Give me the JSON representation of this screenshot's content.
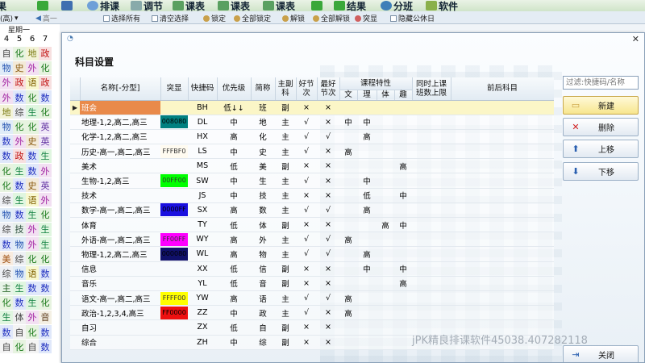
{
  "toolbar": {
    "items": [
      "排课",
      "调节",
      "课表",
      "课表",
      "课表",
      "结果",
      "分班",
      "软件"
    ]
  },
  "subbar": {
    "left_label": "(高)",
    "grade": "高一",
    "select_all": "选择所有",
    "clear_select": "清空选择",
    "lock": "锁定",
    "lock_all": "全部锁定",
    "unlock": "解锁",
    "unlock_all": "全部解锁",
    "highlight": "突显",
    "hide_holiday": "隐藏公休日"
  },
  "bg_grid": {
    "weekday": "星期一",
    "period_numbers": [
      "4",
      "5",
      "6",
      "7"
    ],
    "rows": [
      [
        "自",
        "化",
        "地",
        "政"
      ],
      [
        "物",
        "史",
        "外",
        "化"
      ],
      [
        "外",
        "政",
        "语",
        "政"
      ],
      [
        "外",
        "数",
        "化",
        "数"
      ],
      [
        "地",
        "综",
        "生",
        "化"
      ],
      [
        "物",
        "化",
        "化",
        "英"
      ],
      [
        "数",
        "外",
        "史",
        "英"
      ],
      [
        "数",
        "政",
        "数",
        "生"
      ],
      [
        "化",
        "生",
        "数",
        "外"
      ],
      [
        "化",
        "数",
        "史",
        "英"
      ],
      [
        "综",
        "生",
        "语",
        "外"
      ],
      [
        "物",
        "数",
        "生",
        "化"
      ],
      [
        "综",
        "技",
        "外",
        "生"
      ],
      [
        "数",
        "物",
        "外",
        "生"
      ],
      [
        "美",
        "综",
        "化",
        "化"
      ],
      [
        "综",
        "物",
        "语",
        "数"
      ],
      [
        "主",
        "生",
        "数",
        "数"
      ],
      [
        "化",
        "数",
        "生",
        "化"
      ],
      [
        "生",
        "体",
        "外",
        "音"
      ],
      [
        "数",
        "自",
        "化",
        "数"
      ],
      [
        "自",
        "化",
        "自",
        "数"
      ]
    ]
  },
  "dialog": {
    "title": "科目设置",
    "filter_placeholder": "过滤:快捷码/名称",
    "buttons": {
      "new": "新建",
      "delete": "删除",
      "move_up": "上移",
      "move_down": "下移",
      "close": "关闭"
    },
    "watermark": "jPK精良排课软件45038.407282118"
  },
  "table": {
    "headers": {
      "name": "名称[-分型]",
      "highlight": "突显",
      "shortcode": "快捷码",
      "priority": "优先级",
      "abbr": "简称",
      "main_sub": "主副科",
      "good_period": "好节次",
      "best_period": "最好节次",
      "course_traits": "课程特性",
      "trait_cols": [
        "文",
        "理",
        "体",
        "趣"
      ],
      "simultaneous": "同时上课班数上限",
      "prerequisite": "前后科目"
    },
    "rows": [
      {
        "name": "班会",
        "color": "",
        "color_hex": "",
        "code": "BH",
        "priority": "低↓↓",
        "abbr": "班",
        "main": "副",
        "good": "×",
        "best": "×",
        "wen": "",
        "li": "",
        "ti": "",
        "qu": ""
      },
      {
        "name": "地理-1,2,高二,高三",
        "color": "008080",
        "color_hex": "#008080",
        "code": "DL",
        "priority": "中",
        "abbr": "地",
        "main": "主",
        "good": "√",
        "best": "×",
        "wen": "中",
        "li": "中",
        "ti": "",
        "qu": ""
      },
      {
        "name": "化学-1,2,高二,高三",
        "color": "",
        "color_hex": "",
        "code": "HX",
        "priority": "高",
        "abbr": "化",
        "main": "主",
        "good": "√",
        "best": "√",
        "wen": "",
        "li": "高",
        "ti": "",
        "qu": ""
      },
      {
        "name": "历史-高一,高二,高三",
        "color": "FFFBF0",
        "color_hex": "#FFFBF0",
        "code": "LS",
        "priority": "中",
        "abbr": "史",
        "main": "主",
        "good": "√",
        "best": "×",
        "wen": "高",
        "li": "",
        "ti": "",
        "qu": ""
      },
      {
        "name": "美术",
        "color": "",
        "color_hex": "",
        "code": "MS",
        "priority": "低",
        "abbr": "美",
        "main": "副",
        "good": "×",
        "best": "×",
        "wen": "",
        "li": "",
        "ti": "",
        "qu": "高"
      },
      {
        "name": "生物-1,2,高三",
        "color": "00FF00",
        "color_hex": "#00FF00",
        "code": "SW",
        "priority": "中",
        "abbr": "生",
        "main": "主",
        "good": "√",
        "best": "×",
        "wen": "",
        "li": "中",
        "ti": "",
        "qu": ""
      },
      {
        "name": "技术",
        "color": "",
        "color_hex": "",
        "code": "JS",
        "priority": "中",
        "abbr": "技",
        "main": "主",
        "good": "×",
        "best": "×",
        "wen": "",
        "li": "低",
        "ti": "",
        "qu": "中"
      },
      {
        "name": "数学-高一,高二,高三",
        "color": "0000FF",
        "color_hex": "#1a10e0",
        "code": "SX",
        "priority": "高",
        "abbr": "数",
        "main": "主",
        "good": "√",
        "best": "√",
        "wen": "",
        "li": "高",
        "ti": "",
        "qu": ""
      },
      {
        "name": "体育",
        "color": "",
        "color_hex": "",
        "code": "TY",
        "priority": "低",
        "abbr": "体",
        "main": "副",
        "good": "×",
        "best": "×",
        "wen": "",
        "li": "",
        "ti": "高",
        "qu": "中"
      },
      {
        "name": "外语-高一,高二,高三",
        "color": "FF00FF",
        "color_hex": "#FF00FF",
        "code": "WY",
        "priority": "高",
        "abbr": "外",
        "main": "主",
        "good": "√",
        "best": "√",
        "wen": "高",
        "li": "",
        "ti": "",
        "qu": ""
      },
      {
        "name": "物理-1,2,高二,高三",
        "color": "000080",
        "color_hex": "#10106a",
        "code": "WL",
        "priority": "高",
        "abbr": "物",
        "main": "主",
        "good": "√",
        "best": "√",
        "wen": "",
        "li": "高",
        "ti": "",
        "qu": ""
      },
      {
        "name": "信息",
        "color": "",
        "color_hex": "",
        "code": "XX",
        "priority": "低",
        "abbr": "信",
        "main": "副",
        "good": "×",
        "best": "×",
        "wen": "",
        "li": "中",
        "ti": "",
        "qu": "中"
      },
      {
        "name": "音乐",
        "color": "",
        "color_hex": "",
        "code": "YL",
        "priority": "低",
        "abbr": "音",
        "main": "副",
        "good": "×",
        "best": "×",
        "wen": "",
        "li": "",
        "ti": "",
        "qu": "高"
      },
      {
        "name": "语文-高一,高二,高三",
        "color": "FFFF00",
        "color_hex": "#FFFF00",
        "code": "YW",
        "priority": "高",
        "abbr": "语",
        "main": "主",
        "good": "√",
        "best": "√",
        "wen": "高",
        "li": "",
        "ti": "",
        "qu": ""
      },
      {
        "name": "政治-1,2,3,4,高三",
        "color": "FF0000",
        "color_hex": "#EE1010",
        "code": "ZZ",
        "priority": "中",
        "abbr": "政",
        "main": "主",
        "good": "√",
        "best": "×",
        "wen": "高",
        "li": "",
        "ti": "",
        "qu": ""
      },
      {
        "name": "自习",
        "color": "",
        "color_hex": "",
        "code": "ZX",
        "priority": "低",
        "abbr": "自",
        "main": "副",
        "good": "×",
        "best": "×",
        "wen": "",
        "li": "",
        "ti": "",
        "qu": ""
      },
      {
        "name": "综合",
        "color": "",
        "color_hex": "",
        "code": "ZH",
        "priority": "中",
        "abbr": "综",
        "main": "副",
        "good": "×",
        "best": "×",
        "wen": "",
        "li": "",
        "ti": "",
        "qu": ""
      }
    ]
  },
  "colors": {
    "selected_row": "#fbf6c7",
    "selected_name": "#e98a4a",
    "header_bg": "#e2ebf3"
  }
}
